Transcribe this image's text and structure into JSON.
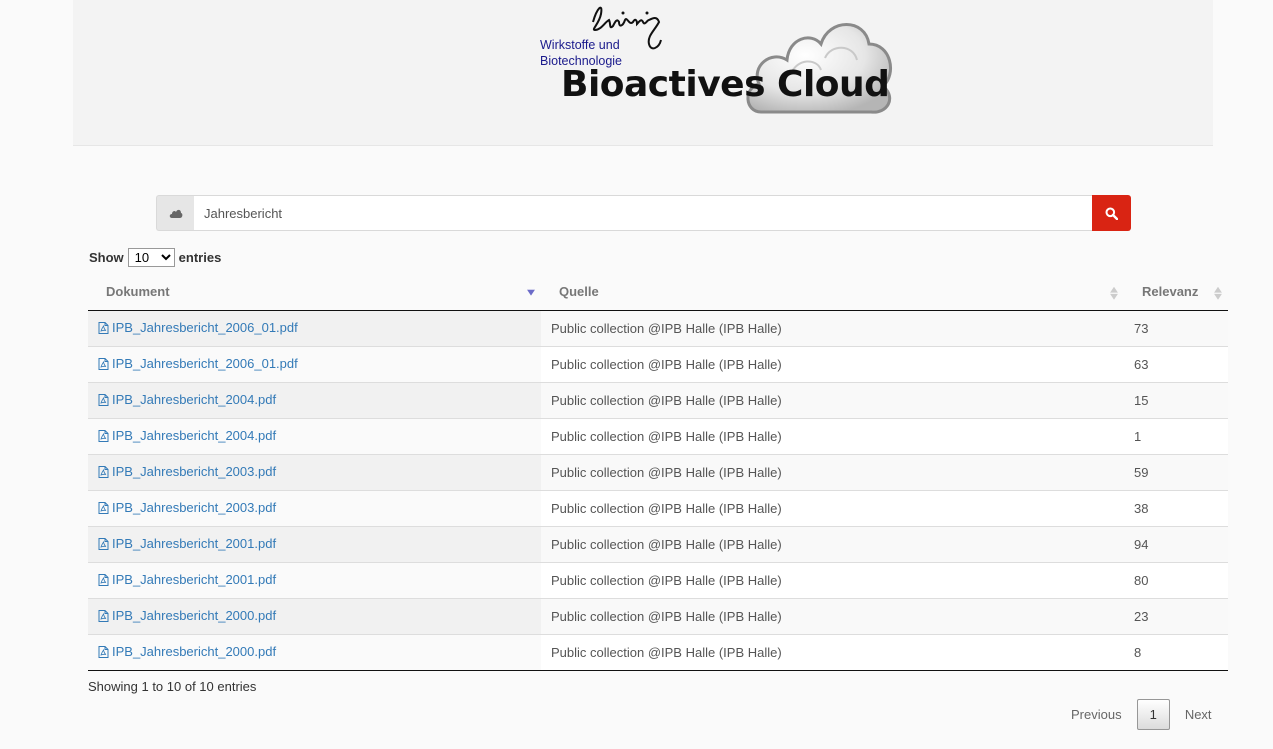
{
  "header": {
    "subtitle": "Wirkstoffe und\nBiotechnologie",
    "title": "Bioactives Cloud"
  },
  "search": {
    "value": "Jahresbericht",
    "addon_icon": "cloud-icon",
    "button_icon": "search-icon",
    "button_color": "#d92413"
  },
  "length": {
    "show_label": "Show",
    "selected": "10",
    "entries_label": "entries"
  },
  "table": {
    "columns": [
      "Dokument",
      "Quelle",
      "Relevanz"
    ],
    "rows": [
      {
        "doc": "IPB_Jahresbericht_2006_01.pdf",
        "source": "Public collection @IPB Halle (IPB Halle)",
        "rel": "73"
      },
      {
        "doc": "IPB_Jahresbericht_2006_01.pdf",
        "source": "Public collection @IPB Halle (IPB Halle)",
        "rel": "63"
      },
      {
        "doc": "IPB_Jahresbericht_2004.pdf",
        "source": "Public collection @IPB Halle (IPB Halle)",
        "rel": "15"
      },
      {
        "doc": "IPB_Jahresbericht_2004.pdf",
        "source": "Public collection @IPB Halle (IPB Halle)",
        "rel": "1"
      },
      {
        "doc": "IPB_Jahresbericht_2003.pdf",
        "source": "Public collection @IPB Halle (IPB Halle)",
        "rel": "59"
      },
      {
        "doc": "IPB_Jahresbericht_2003.pdf",
        "source": "Public collection @IPB Halle (IPB Halle)",
        "rel": "38"
      },
      {
        "doc": "IPB_Jahresbericht_2001.pdf",
        "source": "Public collection @IPB Halle (IPB Halle)",
        "rel": "94"
      },
      {
        "doc": "IPB_Jahresbericht_2001.pdf",
        "source": "Public collection @IPB Halle (IPB Halle)",
        "rel": "80"
      },
      {
        "doc": "IPB_Jahresbericht_2000.pdf",
        "source": "Public collection @IPB Halle (IPB Halle)",
        "rel": "23"
      },
      {
        "doc": "IPB_Jahresbericht_2000.pdf",
        "source": "Public collection @IPB Halle (IPB Halle)",
        "rel": "8"
      }
    ]
  },
  "info": "Showing 1 to 10 of 10 entries",
  "pager": {
    "previous": "Previous",
    "current": "1",
    "next": "Next"
  }
}
